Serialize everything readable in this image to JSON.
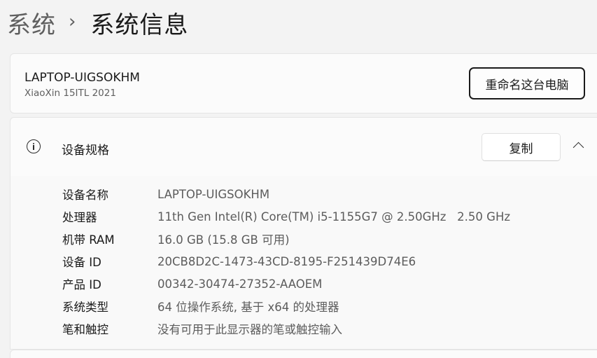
{
  "breadcrumb": {
    "parent": "系统",
    "separator": "›",
    "current": "系统信息"
  },
  "device": {
    "name": "LAPTOP-UIGSOKHM",
    "model": "XiaoXin 15ITL 2021",
    "rename_button_label": "重命名这台电脑"
  },
  "specs": {
    "title": "设备规格",
    "icon": "info-icon",
    "copy_button_label": "复制",
    "expanded": true,
    "rows": [
      {
        "label": "设备名称",
        "value": "LAPTOP-UIGSOKHM"
      },
      {
        "label": "处理器",
        "value": "11th Gen Intel(R) Core(TM) i5-1155G7 @ 2.50GHz   2.50 GHz"
      },
      {
        "label": "机带 RAM",
        "value": "16.0 GB (15.8 GB 可用)"
      },
      {
        "label": "设备 ID",
        "value": "20CB8D2C-1473-43CD-8195-F251439D74E6"
      },
      {
        "label": "产品 ID",
        "value": "00342-30474-27352-AAOEM"
      },
      {
        "label": "系统类型",
        "value": "64 位操作系统, 基于 x64 的处理器"
      },
      {
        "label": "笔和触控",
        "value": "没有可用于此显示器的笔或触控输入"
      }
    ]
  }
}
